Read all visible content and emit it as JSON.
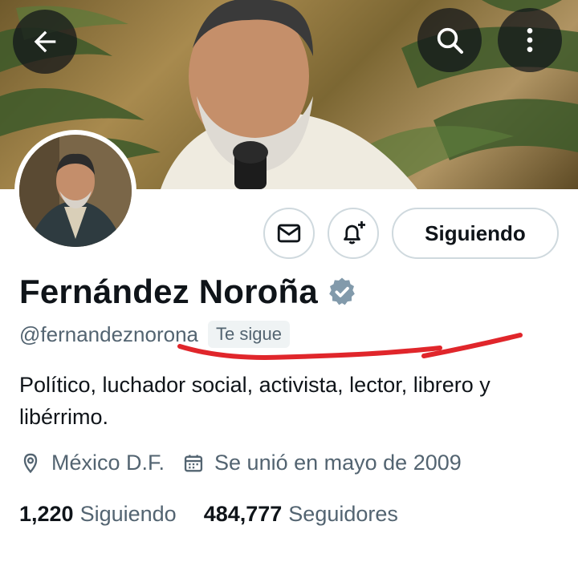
{
  "nav": {
    "back_icon": "arrow-left-icon",
    "search_icon": "search-icon",
    "more_icon": "more-vertical-icon"
  },
  "profile": {
    "name": "Fernández Noroña",
    "verified": true,
    "handle": "@fernandeznorona",
    "follows_you_badge": "Te sigue",
    "bio": "Político, luchador social, activista, lector, librero y libérrimo.",
    "location": "México D.F.",
    "joined": "Se unió en mayo de 2009",
    "following_count": "1,220",
    "following_label": "Siguiendo",
    "followers_count": "484,777",
    "followers_label": "Seguidores"
  },
  "actions": {
    "message_icon": "envelope-icon",
    "notify_icon": "bell-plus-icon",
    "follow_label": "Siguiendo"
  },
  "colors": {
    "verified_badge": "#829aab",
    "secondary_text": "#536471",
    "annotation_red": "#e0262b"
  }
}
